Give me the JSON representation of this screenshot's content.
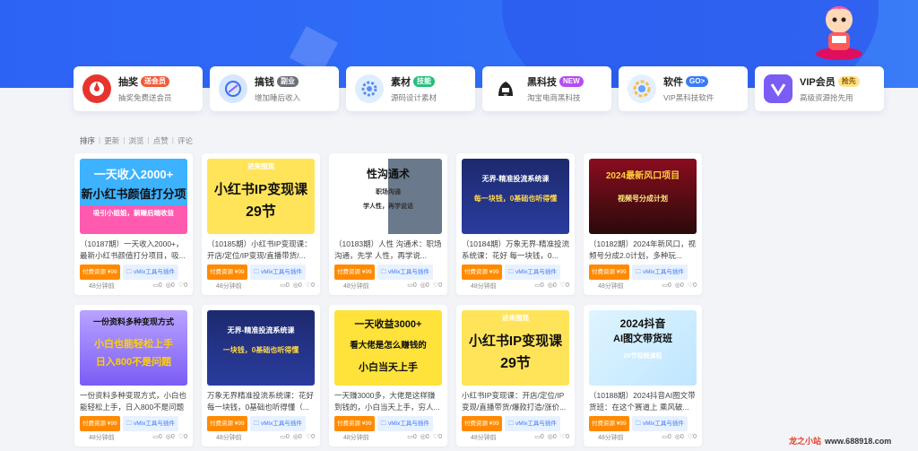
{
  "nav": [
    {
      "title": "抽奖",
      "badge": "送会员",
      "badge_color": "#f25c3b",
      "sub": "抽奖免费送会员",
      "icon": "lottery-icon",
      "icon_bg": "#e8342e"
    },
    {
      "title": "搞钱",
      "badge": "副业",
      "badge_color": "#6b6f7a",
      "sub": "增加睡后收入",
      "icon": "money-icon",
      "icon_bg": "#d6e6ff"
    },
    {
      "title": "素材",
      "badge": "技能",
      "badge_color": "#21c07a",
      "sub": "源码设计素材",
      "icon": "gear-icon",
      "icon_bg": "#dfeeff"
    },
    {
      "title": "黑科技",
      "badge": "NEW",
      "badge_color": "#b54cf2",
      "sub": "淘宝电商黑科技",
      "icon": "hacker-icon",
      "icon_bg": "#ffffff"
    },
    {
      "title": "软件",
      "badge": "GO>",
      "badge_color": "#3a7bf7",
      "sub": "VIP黑科技软件",
      "icon": "settings-icon",
      "icon_bg": "#e4efff"
    },
    {
      "title": "VIP会员",
      "badge": "抢先",
      "badge_color": "#ffe28a",
      "sub": "高级资源抢先用",
      "icon": "vip-icon",
      "icon_bg": "#7b5cf5"
    }
  ],
  "sort": {
    "label": "排序",
    "options": [
      "更新",
      "浏览",
      "点赞",
      "评论"
    ]
  },
  "tag_pay": "付费资源 ¥99",
  "tag_cat": "vMix工具与插件",
  "time": "48分钟前",
  "stats": [
    "0",
    "0",
    "0"
  ],
  "cards": [
    {
      "title": "（10187期）一天收入2000+，最新小红书颜值打分项目，吸...",
      "thumb_lines": [
        "一天收入2000+",
        "新小红书颜值打分项",
        "吸引小姐姐，躺赚后端收益"
      ]
    },
    {
      "title": "（10185期）小红书IP变现课：开店/定位/IP变现/直播带货/...",
      "thumb_lines": [
        "进来围观",
        "小红书IP变现课",
        "29节"
      ]
    },
    {
      "title": "（10183期）人性 沟通术：职场沟通，先学 人性，再学说...",
      "thumb_lines": [
        "性沟通术",
        "职场沟通",
        "学人性，再学说话"
      ]
    },
    {
      "title": "（10184期）万象无界-精准投流系统课：花好 每一块钱，0...",
      "thumb_lines": [
        "无界-精准投流系统课",
        "每一块钱，0基础也听得懂"
      ]
    },
    {
      "title": "（10182期）2024年新风口，视频号分成2.0计划，多种玩...",
      "thumb_lines": [
        "2024最新风口项目",
        "视频号分成计划"
      ]
    },
    {
      "title": "一份资料多种变现方式，小白也能轻松上手，日入800不是问题",
      "thumb_lines": [
        "一份资料多种变现方式",
        "小白也能轻松上手",
        "日入800不是问题"
      ]
    },
    {
      "title": "万象无界精准投流系统课：花好每一块钱，0基础也听得懂（...",
      "thumb_lines": [
        "无界-精准投流系统课",
        "一块钱，0基础也听得懂"
      ]
    },
    {
      "title": "一天赚3000多，大佬是这样赚到钱的，小白当天上手，穷人...",
      "thumb_lines": [
        "一天收益3000+",
        "看大佬是怎么赚钱的",
        "小白当天上手"
      ]
    },
    {
      "title": "小红书IP变现课：开店/定位/IP变现/直播带货/爆款打造/涨价...",
      "thumb_lines": [
        "进来围观",
        "小红书IP变现课",
        "29节"
      ]
    },
    {
      "title": "（10188期）2024抖音AI图文带货班：在这个赛道上 乘风破...",
      "thumb_lines": [
        "2024抖音",
        "AI图文带货班",
        "26节视频课程"
      ]
    }
  ],
  "watermark": {
    "brand": "龙之小站",
    "url": "www.688918.com"
  }
}
